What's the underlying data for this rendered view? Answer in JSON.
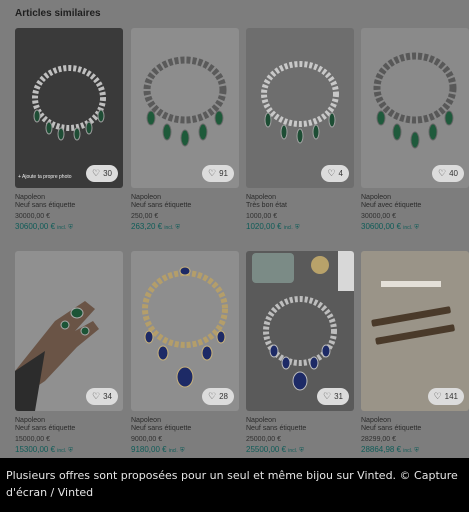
{
  "section": {
    "title": "Articles similaires"
  },
  "items": [
    {
      "brand": "Napoleon",
      "condition": "Neuf sans étiquette",
      "price": "30000,00 €",
      "price_incl": "30600,00 €",
      "incl_label": "incl.",
      "favorites": "30",
      "photo_tag": "+ Ajoute ta propre photo",
      "photo": "emerald-necklace"
    },
    {
      "brand": "Napoleon",
      "condition": "Neuf sans étiquette",
      "price": "250,00 €",
      "price_incl": "263,20 €",
      "incl_label": "incl.",
      "favorites": "91",
      "photo": "emerald-necklace"
    },
    {
      "brand": "Napoleon",
      "condition": "Très bon état",
      "price": "1000,00 €",
      "price_incl": "1020,00 €",
      "incl_label": "incl.",
      "favorites": "4",
      "photo": "emerald-necklace"
    },
    {
      "brand": "Napoleon",
      "condition": "Neuf avec étiquette",
      "price": "30000,00 €",
      "price_incl": "30600,00 €",
      "incl_label": "incl.",
      "favorites": "40",
      "photo": "emerald-necklace"
    },
    {
      "brand": "Napoleon",
      "condition": "Neuf sans étiquette",
      "price": "15000,00 €",
      "price_incl": "15300,00 €",
      "incl_label": "incl.",
      "favorites": "34",
      "photo": "hand-with-ring"
    },
    {
      "brand": "Napoleon",
      "condition": "Neuf sans étiquette",
      "price": "9000,00 €",
      "price_incl": "9180,00 €",
      "incl_label": "incl.",
      "favorites": "28",
      "photo": "sapphire-necklace"
    },
    {
      "brand": "Napoleon",
      "condition": "Neuf sans étiquette",
      "price": "25000,00 €",
      "price_incl": "25500,00 €",
      "incl_label": "incl.",
      "favorites": "31",
      "photo": "sapphire-necklace-phone"
    },
    {
      "brand": "Napoleon",
      "condition": "Neuf sans étiquette",
      "price": "28299,00 €",
      "price_incl": "28864,98 €",
      "incl_label": "incl.",
      "favorites": "141",
      "photo": "bracelets"
    }
  ],
  "caption": "Plusieurs offres sont proposées pour un seul et même bijou sur Vinted. © Capture d'écran / Vinted",
  "colors": {
    "panel": "#7d7d7d",
    "price_incl": "#0f5c58",
    "fav_pill": "#dcdcdc",
    "page": "#000000"
  },
  "icons": {
    "favorite": "heart-icon",
    "buyer_protection": "shield-icon"
  }
}
